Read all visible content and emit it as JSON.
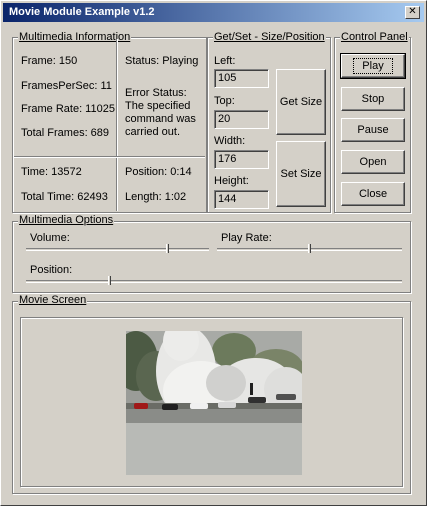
{
  "window": {
    "title": "Movie Module Example v1.2",
    "close_label": "✕"
  },
  "info": {
    "legend": "Multimedia Information",
    "frame": "Frame: 150",
    "fps": "FramesPerSec: 11",
    "frame_rate": "Frame Rate: 11025",
    "total_frames": "Total Frames: 689",
    "status": "Status: Playing",
    "error_label": "Error Status:",
    "error_lines": [
      "The specified",
      "command was",
      "carried out."
    ],
    "time": "Time: 13572",
    "total_time": "Total Time: 62493",
    "position": "Position: 0:14",
    "length": "Length: 1:02"
  },
  "getset": {
    "legend": "Get/Set - Size/Position",
    "left_label": "Left:",
    "left_value": "105",
    "top_label": "Top:",
    "top_value": "20",
    "width_label": "Width:",
    "width_value": "176",
    "height_label": "Height:",
    "height_value": "144",
    "get_size": "Get Size",
    "set_size": "Set Size"
  },
  "control": {
    "legend": "Control Panel",
    "buttons": [
      "Play",
      "Stop",
      "Pause",
      "Open",
      "Close"
    ]
  },
  "options": {
    "legend": "Multimedia Options",
    "volume_label": "Volume:",
    "play_rate_label": "Play Rate:",
    "position_label": "Position:",
    "volume_level": 0.78,
    "play_rate_level": 0.5,
    "position_level": 0.22
  },
  "movie": {
    "legend": "Movie Screen"
  },
  "colors": {
    "title_start": "#0a246a",
    "title_end": "#a6caf0",
    "face": "#d4d0c8"
  }
}
